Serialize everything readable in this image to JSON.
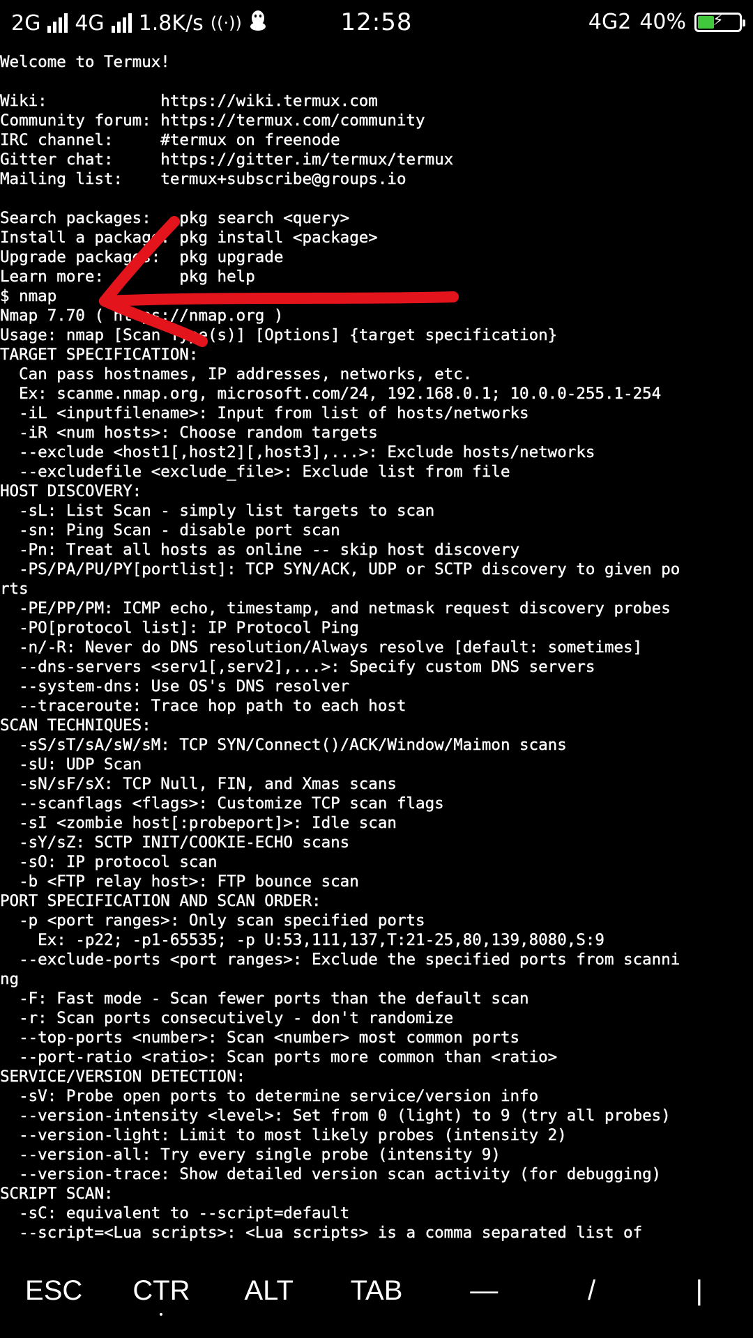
{
  "status_bar": {
    "network_left": "2G",
    "network_mid": "4G",
    "speed": "1.8K/s",
    "time": "12:58",
    "network_right": "4G2",
    "battery_percent": "40%",
    "battery_level": 0.4,
    "icons": [
      "signal-icon",
      "signal-icon",
      "hotspot-icon",
      "qq-penguin-icon",
      "lte-icon",
      "battery-charging-icon"
    ]
  },
  "terminal": {
    "lines": [
      "Welcome to Termux!",
      "",
      "Wiki:            https://wiki.termux.com",
      "Community forum: https://termux.com/community",
      "IRC channel:     #termux on freenode",
      "Gitter chat:     https://gitter.im/termux/termux",
      "Mailing list:    termux+subscribe@groups.io",
      "",
      "Search packages:   pkg search <query>",
      "Install a package: pkg install <package>",
      "Upgrade packages:  pkg upgrade",
      "Learn more:        pkg help",
      "$ nmap",
      "Nmap 7.70 ( https://nmap.org )",
      "Usage: nmap [Scan Type(s)] [Options] {target specification}",
      "TARGET SPECIFICATION:",
      "  Can pass hostnames, IP addresses, networks, etc.",
      "  Ex: scanme.nmap.org, microsoft.com/24, 192.168.0.1; 10.0.0-255.1-254",
      "  -iL <inputfilename>: Input from list of hosts/networks",
      "  -iR <num hosts>: Choose random targets",
      "  --exclude <host1[,host2][,host3],...>: Exclude hosts/networks",
      "  --excludefile <exclude_file>: Exclude list from file",
      "HOST DISCOVERY:",
      "  -sL: List Scan - simply list targets to scan",
      "  -sn: Ping Scan - disable port scan",
      "  -Pn: Treat all hosts as online -- skip host discovery",
      "  -PS/PA/PU/PY[portlist]: TCP SYN/ACK, UDP or SCTP discovery to given po",
      "rts",
      "  -PE/PP/PM: ICMP echo, timestamp, and netmask request discovery probes",
      "  -PO[protocol list]: IP Protocol Ping",
      "  -n/-R: Never do DNS resolution/Always resolve [default: sometimes]",
      "  --dns-servers <serv1[,serv2],...>: Specify custom DNS servers",
      "  --system-dns: Use OS's DNS resolver",
      "  --traceroute: Trace hop path to each host",
      "SCAN TECHNIQUES:",
      "  -sS/sT/sA/sW/sM: TCP SYN/Connect()/ACK/Window/Maimon scans",
      "  -sU: UDP Scan",
      "  -sN/sF/sX: TCP Null, FIN, and Xmas scans",
      "  --scanflags <flags>: Customize TCP scan flags",
      "  -sI <zombie host[:probeport]>: Idle scan",
      "  -sY/sZ: SCTP INIT/COOKIE-ECHO scans",
      "  -sO: IP protocol scan",
      "  -b <FTP relay host>: FTP bounce scan",
      "PORT SPECIFICATION AND SCAN ORDER:",
      "  -p <port ranges>: Only scan specified ports",
      "    Ex: -p22; -p1-65535; -p U:53,111,137,T:21-25,80,139,8080,S:9",
      "  --exclude-ports <port ranges>: Exclude the specified ports from scanni",
      "ng",
      "  -F: Fast mode - Scan fewer ports than the default scan",
      "  -r: Scan ports consecutively - don't randomize",
      "  --top-ports <number>: Scan <number> most common ports",
      "  --port-ratio <ratio>: Scan ports more common than <ratio>",
      "SERVICE/VERSION DETECTION:",
      "  -sV: Probe open ports to determine service/version info",
      "  --version-intensity <level>: Set from 0 (light) to 9 (try all probes)",
      "  --version-light: Limit to most likely probes (intensity 2)",
      "  --version-all: Try every single probe (intensity 9)",
      "  --version-trace: Show detailed version scan activity (for debugging)",
      "SCRIPT SCAN:",
      "  -sC: equivalent to --script=default",
      "  --script=<Lua scripts>: <Lua scripts> is a comma separated list of"
    ]
  },
  "annotation": {
    "color": "#e3141c"
  },
  "extra_keys": [
    "ESC",
    "CTR",
    "ALT",
    "TAB",
    "—",
    "/",
    "|"
  ]
}
